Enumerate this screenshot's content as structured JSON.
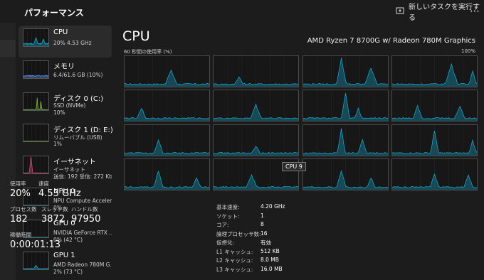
{
  "titlebar": {
    "title": "パフォーマンス",
    "new_task_label": "新しいタスクを実行する",
    "more_label": "⋯"
  },
  "sidebar": {
    "items": [
      {
        "name": "CPU",
        "sub1": "20%  4.53 GHz",
        "sub2": "",
        "sub3": "",
        "color": "#17a4c8",
        "active": true
      },
      {
        "name": "メモリ",
        "sub1": "6.4/61.6 GB (10%)",
        "sub2": "",
        "sub3": "",
        "color": "#5b89d6"
      },
      {
        "name": "ディスク 0 (C:)",
        "sub1": "SSD (NVMe)",
        "sub2": "10%",
        "sub3": "",
        "color": "#7cb342"
      },
      {
        "name": "ディスク 1 (D: E:)",
        "sub1": "リムーバブル (USB)",
        "sub2": "1%",
        "sub3": "",
        "color": "#7cb342"
      },
      {
        "name": "イーサネット",
        "sub1": "イーサネット",
        "sub2": "送信: 192  受信: 272 Kb",
        "sub3": "",
        "color": "#d04a77"
      },
      {
        "name": "NPU 0",
        "sub1": "NPU Compute Acceler...",
        "sub2": "0%",
        "sub3": "",
        "color": "#17a4c8"
      },
      {
        "name": "GPU 0",
        "sub1": "NVIDIA GeForce RTX ...",
        "sub2": "0% (42 °C)",
        "sub3": "",
        "color": "#17a4c8"
      },
      {
        "name": "GPU 1",
        "sub1": "AMD Radeon 780M G...",
        "sub2": "2% (73 °C)",
        "sub3": "",
        "color": "#17a4c8"
      }
    ]
  },
  "main": {
    "title": "CPU",
    "model": "AMD Ryzen 7 8700G w/ Radeon 780M Graphics",
    "util_label": "60 秒間の使用率 (%)",
    "max_label": "100%",
    "tooltip": "CPU 9",
    "graph_color": "#17a4c8"
  },
  "stats": {
    "usage_label": "使用率",
    "usage_value": "20%",
    "speed_label": "速度",
    "speed_value": "4.53 GHz",
    "proc_label": "プロセス数",
    "proc_value": "182",
    "threads_label": "スレッド数",
    "threads_value": "3872",
    "handles_label": "ハンドル数",
    "handles_value": "97950",
    "uptime_label": "稼働時間",
    "uptime_value": "0:00:01:13"
  },
  "specs": [
    {
      "k": "基本速度:",
      "v": "4.20 GHz"
    },
    {
      "k": "ソケット:",
      "v": "1"
    },
    {
      "k": "コア:",
      "v": "8"
    },
    {
      "k": "論理プロセッサ数:",
      "v": "16"
    },
    {
      "k": "仮想化:",
      "v": "有効"
    },
    {
      "k": "L1 キャッシュ:",
      "v": "512 KB"
    },
    {
      "k": "L2 キャッシュ:",
      "v": "8.0 MB"
    },
    {
      "k": "L3 キャッシュ:",
      "v": "16.0 MB"
    }
  ]
}
